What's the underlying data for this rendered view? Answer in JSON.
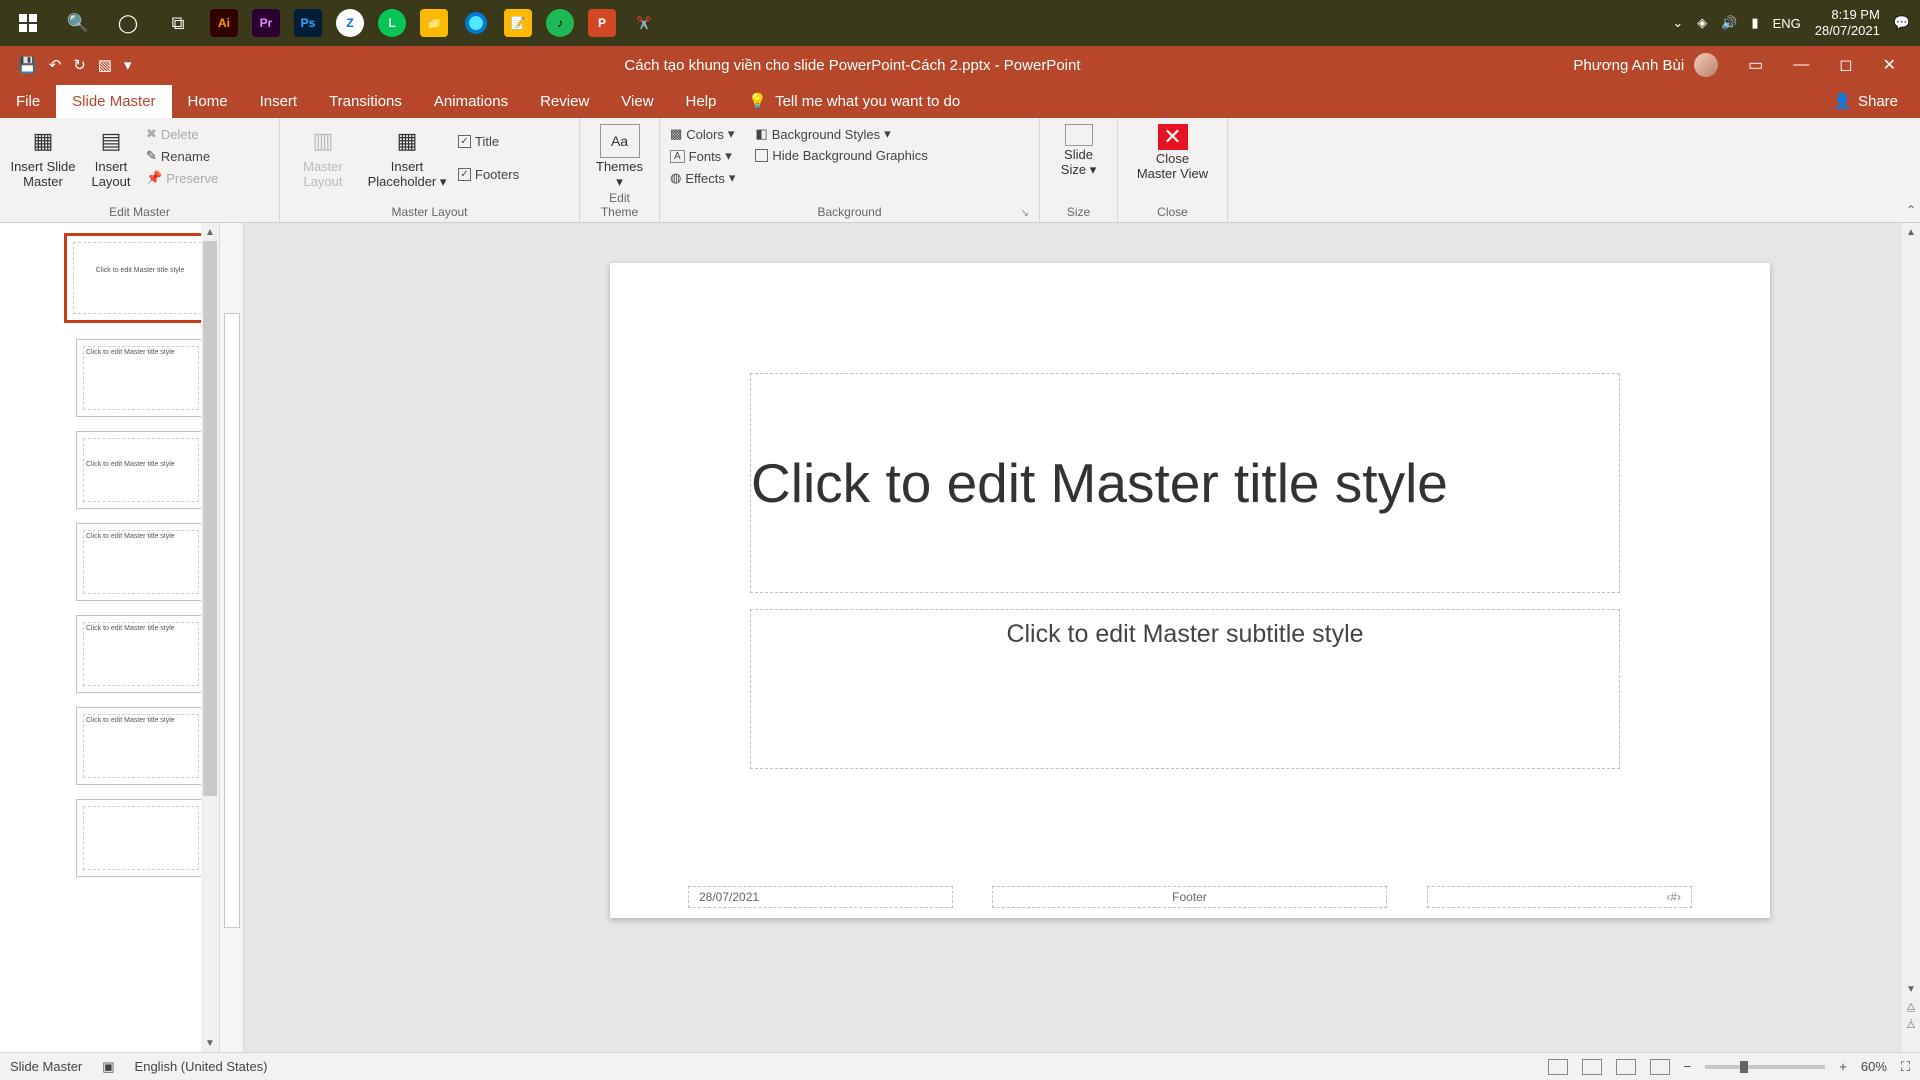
{
  "taskbar": {
    "apps": [
      "Ai",
      "Pr",
      "Ps",
      "Zalo",
      "LINE",
      "Files",
      "Edge",
      "Notes",
      "Spotify",
      "PPT",
      "Snip"
    ],
    "lang": "ENG",
    "time": "8:19 PM",
    "date": "28/07/2021"
  },
  "titlebar": {
    "document": "Cách tạo khung viền cho slide PowerPoint-Cách 2.pptx  -  PowerPoint",
    "user": "Phương Anh Bùi",
    "share": "Share"
  },
  "tabs": {
    "file": "File",
    "slide_master": "Slide Master",
    "home": "Home",
    "insert": "Insert",
    "transitions": "Transitions",
    "animations": "Animations",
    "review": "Review",
    "view": "View",
    "help": "Help",
    "tellme": "Tell me what you want to do"
  },
  "ribbon": {
    "edit_master": {
      "insert_slide_master": "Insert Slide\nMaster",
      "insert_layout": "Insert\nLayout",
      "delete": "Delete",
      "rename": "Rename",
      "preserve": "Preserve",
      "label": "Edit Master"
    },
    "master_layout": {
      "master_layout_btn": "Master\nLayout",
      "insert_placeholder": "Insert\nPlaceholder",
      "title": "Title",
      "footers": "Footers",
      "label": "Master Layout"
    },
    "edit_theme": {
      "themes": "Themes",
      "label": "Edit Theme"
    },
    "background": {
      "colors": "Colors",
      "fonts": "Fonts",
      "effects": "Effects",
      "bg_styles": "Background Styles",
      "hide_bg": "Hide Background Graphics",
      "label": "Background"
    },
    "size": {
      "slide_size": "Slide\nSize",
      "label": "Size"
    },
    "close": {
      "close_master": "Close\nMaster View",
      "label": "Close"
    }
  },
  "slide": {
    "title": "Click to edit Master title style",
    "subtitle": "Click to edit Master subtitle style",
    "date": "28/07/2021",
    "footer": "Footer",
    "num": "‹#›"
  },
  "thumbs": {
    "master_text": "Click to edit Master title style",
    "layout_text": "Click to edit Master title style"
  },
  "statusbar": {
    "mode": "Slide Master",
    "lang": "English (United States)",
    "zoom": "60%"
  }
}
